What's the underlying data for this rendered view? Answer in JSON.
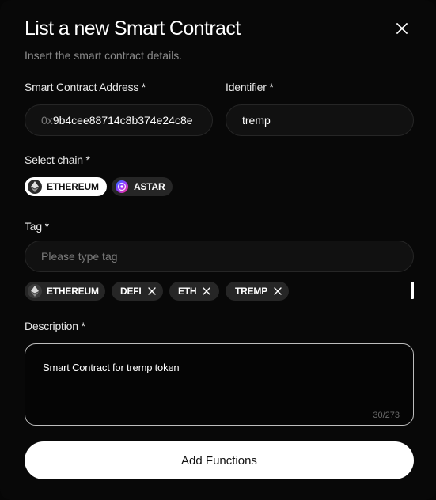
{
  "modal": {
    "title": "List a new Smart Contract",
    "subtitle": "Insert the smart contract details."
  },
  "address": {
    "label": "Smart Contract Address *",
    "value_prefix": "0x",
    "value_rest": "9b4cee88714c8b374e24c8e"
  },
  "identifier": {
    "label": "Identifier *",
    "value": "tremp"
  },
  "chain": {
    "label": "Select chain *",
    "options": [
      {
        "label": "ETHEREUM",
        "icon": "ethereum-icon",
        "selected": true
      },
      {
        "label": "ASTAR",
        "icon": "astar-icon",
        "selected": false
      }
    ]
  },
  "tag": {
    "label": "Tag *",
    "placeholder": "Please type tag",
    "chips": [
      {
        "label": "ETHEREUM",
        "icon": "ethereum-icon",
        "removable": false
      },
      {
        "label": "DEFI",
        "removable": true
      },
      {
        "label": "ETH",
        "removable": true
      },
      {
        "label": "TREMP",
        "removable": true
      }
    ]
  },
  "description": {
    "label": "Description *",
    "value": "Smart Contract for tremp token",
    "counter": "30/273"
  },
  "actions": {
    "primary_label": "Add Functions"
  },
  "colors": {
    "background": "#080808",
    "field_bg": "#111111",
    "chip_bg": "#262626",
    "accent": "#ffffff",
    "muted_text": "#8a8a8a"
  }
}
